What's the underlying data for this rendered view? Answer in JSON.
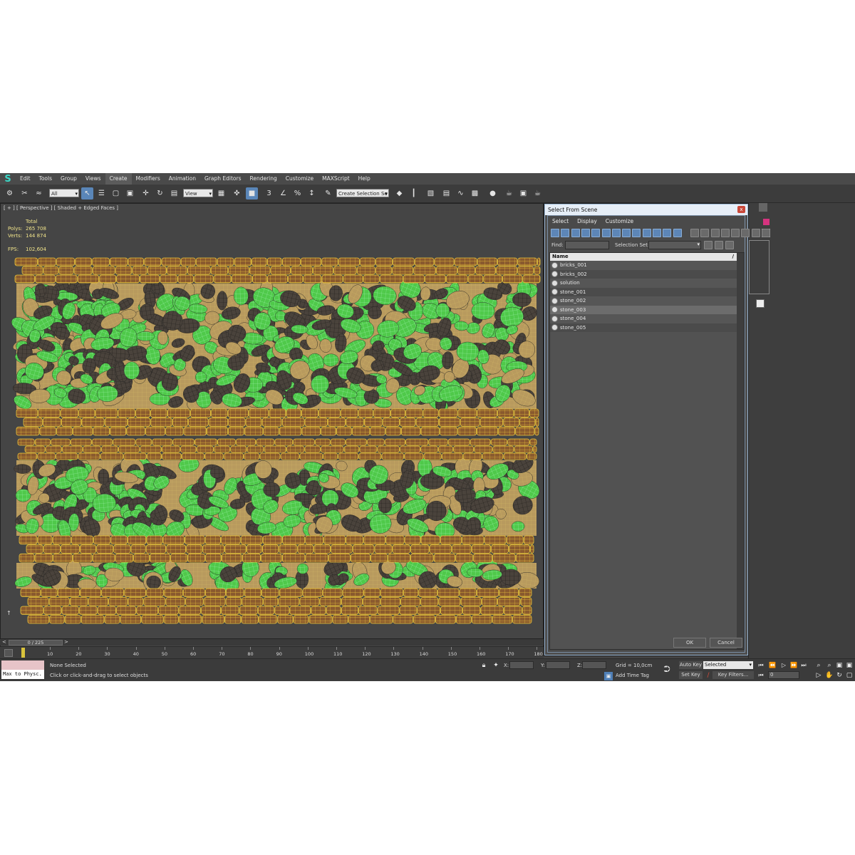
{
  "menu": {
    "logo": "S",
    "items": [
      "Edit",
      "Tools",
      "Group",
      "Views",
      "Create",
      "Modifiers",
      "Animation",
      "Graph Editors",
      "Rendering",
      "Customize",
      "MAXScript",
      "Help"
    ],
    "active_index": 4
  },
  "toolbar": {
    "filter_value": "All",
    "ref_coord_value": "View",
    "selection_set_value": "Create Selection Se",
    "icons": [
      "link-icon",
      "unlink-icon",
      "bind-spacewarp-icon",
      "select-object-icon",
      "select-by-name-icon",
      "rect-region-icon",
      "window-crossing-icon",
      "move-icon",
      "rotate-icon",
      "scale-icon",
      "pivot-icon",
      "select-manipulate-icon",
      "keyboard-shortcut-icon",
      "snap-3d-icon",
      "angle-snap-icon",
      "percent-snap-icon",
      "spinner-snap-icon",
      "named-selection-icon",
      "mirror-icon",
      "align-icon",
      "layer-icon",
      "ribbon-icon",
      "curve-editor-icon",
      "schematic-icon",
      "material-editor-icon",
      "render-setup-icon",
      "render-frame-icon",
      "render-icon"
    ]
  },
  "viewport": {
    "label": "[ + ] [ Perspective ] [ Shaded + Edged Faces ]",
    "stats": {
      "header": "Total",
      "polys_label": "Polys:",
      "polys_value": "265 708",
      "verts_label": "Verts:",
      "verts_value": "144 874",
      "fps_label": "FPS:",
      "fps_value": "102,604"
    }
  },
  "timeline": {
    "slider_text": "0 / 225",
    "left_arrow": "<",
    "right_arrow": ">",
    "ticks": [
      "10",
      "20",
      "30",
      "40",
      "50",
      "60",
      "70",
      "80",
      "90",
      "100",
      "110",
      "120",
      "130",
      "140",
      "150",
      "160",
      "170",
      "180"
    ]
  },
  "status": {
    "maxscript_text": "Max to Physc.",
    "selection": "None Selected",
    "prompt": "Click or click-and-drag to select objects",
    "x_label": "X:",
    "y_label": "Y:",
    "z_label": "Z:",
    "grid": "Grid = 10,0cm",
    "add_time_tag": "Add Time Tag",
    "auto_key": "Auto Key",
    "set_key": "Set Key",
    "selected_value": "Selected",
    "key_filters": "Key Filters...",
    "frame_value": "0"
  },
  "dialog": {
    "title": "Select From Scene",
    "close": "x",
    "menus": [
      "Select",
      "Display",
      "Customize"
    ],
    "find_label": "Find:",
    "selection_set_label": "Selection Set:",
    "column_name": "Name",
    "sort_arrow": "/",
    "items": [
      {
        "name": "bricks_001",
        "selected": false
      },
      {
        "name": "bricks_002",
        "selected": false
      },
      {
        "name": "solution",
        "selected": false
      },
      {
        "name": "stone_001",
        "selected": false
      },
      {
        "name": "stone_002",
        "selected": false
      },
      {
        "name": "stone_003",
        "selected": true
      },
      {
        "name": "stone_004",
        "selected": false
      },
      {
        "name": "stone_005",
        "selected": false
      }
    ],
    "ok_label": "OK",
    "cancel_label": "Cancel"
  },
  "colors": {
    "brick": "#8a5a2e",
    "brick_wire": "#e8c23a",
    "sand": "#b89a5e",
    "green_stone": "#4fc94a",
    "dark_stone": "#4a433c",
    "accent_blue": "#5a86b8"
  }
}
